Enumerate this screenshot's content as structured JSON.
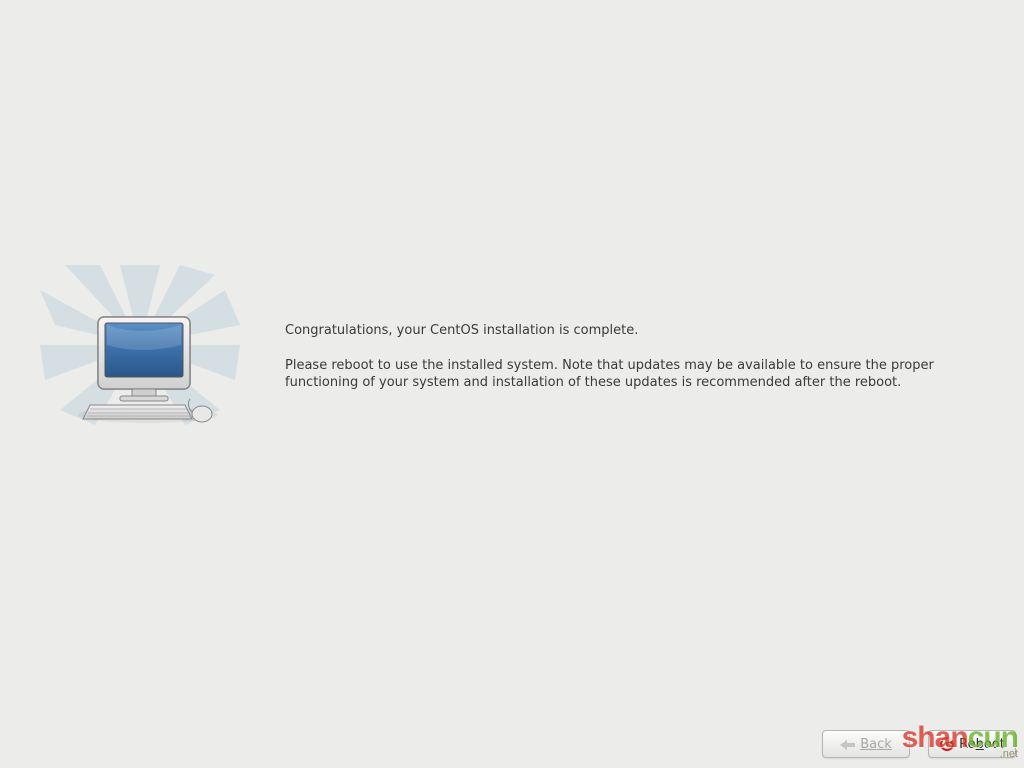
{
  "message": {
    "heading": "Congratulations, your CentOS installation is complete.",
    "body": "Please reboot to use the installed system.  Note that updates may be available to ensure the proper functioning of your system and installation of these updates is recommended after the reboot."
  },
  "buttons": {
    "back_label": "Back",
    "reboot_label": "Reboot"
  },
  "watermark": {
    "text1": "shan",
    "text2": "cun",
    "sub": ".net"
  }
}
